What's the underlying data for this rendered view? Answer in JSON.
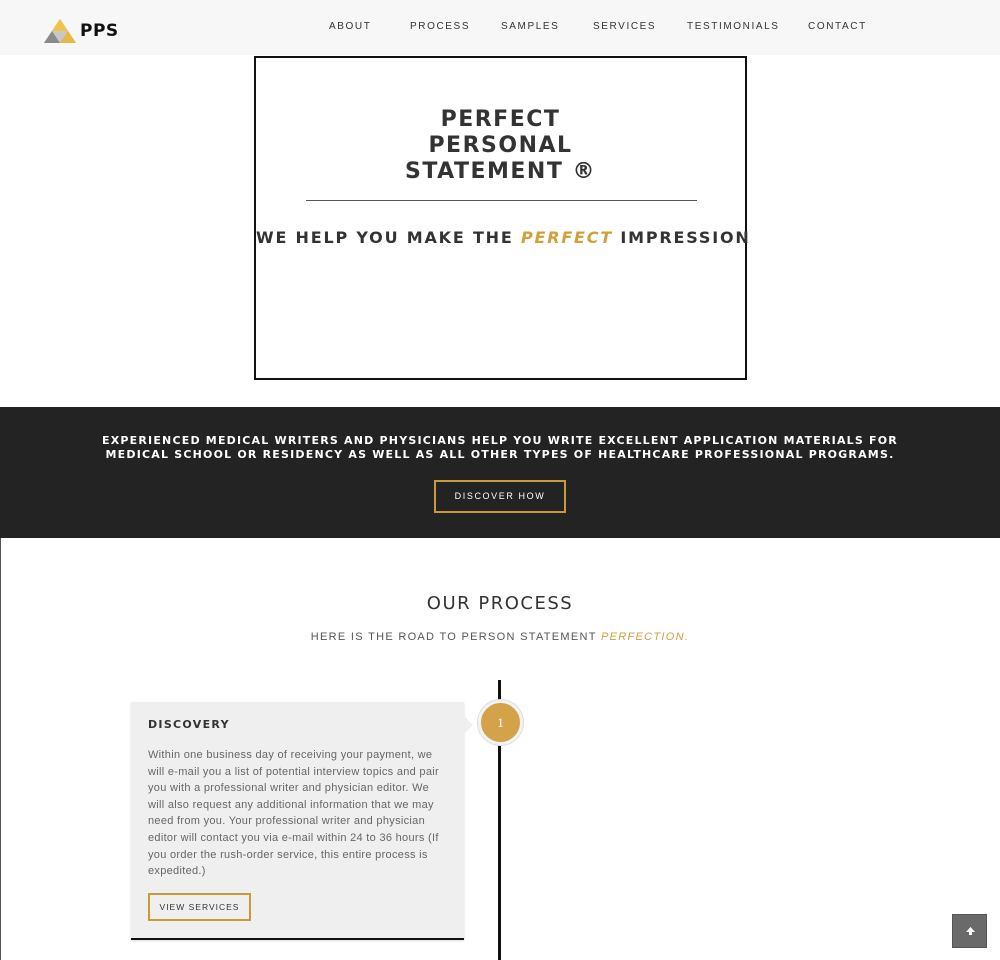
{
  "header": {
    "logo_text": "PPS",
    "logo_colors": [
      "#f0c44a",
      "#d1a03b",
      "#8a8a8a"
    ],
    "nav": [
      {
        "label": "ABOUT"
      },
      {
        "label": "PROCESS"
      },
      {
        "label": "SAMPLES"
      },
      {
        "label": "SERVICES"
      },
      {
        "label": "TESTIMONIALS"
      },
      {
        "label": "CONTACT"
      }
    ]
  },
  "hero": {
    "title_line1": "PERFECT",
    "title_line2": "PERSONAL",
    "title_line3": "STATEMENT ®",
    "sub_before": "WE HELP YOU MAKE THE ",
    "sub_accent": "PERFECT",
    "sub_after": " IMPRESSION"
  },
  "band": {
    "text": "EXPERIENCED MEDICAL WRITERS AND PHYSICIANS HELP YOU WRITE EXCELLENT APPLICATION MATERIALS FOR MEDICAL SCHOOL OR RESIDENCY AS WELL AS ALL OTHER TYPES OF HEALTHCARE PROFESSIONAL PROGRAMS.",
    "button_label": "DISCOVER HOW"
  },
  "process": {
    "title": "OUR PROCESS",
    "sub_before": "HERE IS THE ROAD TO PERSON STATEMENT ",
    "sub_accent": "PERFECTION.",
    "steps": [
      {
        "number": "1",
        "title": "DISCOVERY",
        "body": "Within one business day of receiving your payment, we will e-mail you a list of potential interview topics and pair you with a professional writer and physician editor. We will also request any additional information that we may need from you. Your professional writer and physician editor will contact you via e-mail within 24 to 36 hours (If you order the rush-order service, this entire process is expedited.)",
        "button_label": "VIEW SERVICES"
      }
    ]
  },
  "scroll_top": {
    "icon": "chevron-up-icon"
  },
  "colors": {
    "accent": "#d1a03b",
    "dark_band": "#232323",
    "header_bg": "#f7f7f7"
  }
}
